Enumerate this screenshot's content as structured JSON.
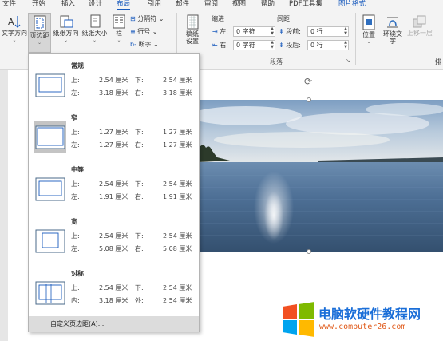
{
  "tabs": [
    "文件",
    "开始",
    "插入",
    "设计",
    "布局",
    "引用",
    "邮件",
    "审阅",
    "视图",
    "帮助",
    "PDF工具集",
    "图片格式"
  ],
  "ribbon": {
    "text_direction": "文字方向",
    "margins": "页边距",
    "orientation": "纸张方向",
    "size": "纸张大小",
    "columns": "栏",
    "breaks": "分隔符",
    "line_numbers": "行号",
    "hyphenation": "断字",
    "paper_setup": "稿纸设置",
    "indent_title": "缩进",
    "spacing_title": "间距",
    "indent_left_label": "左:",
    "indent_left_value": "0 字符",
    "indent_right_label": "右:",
    "indent_right_value": "0 字符",
    "space_before_label": "段前:",
    "space_before_value": "0 行",
    "space_after_label": "段后:",
    "space_after_value": "0 行",
    "paragraph_group": "段落",
    "position": "位置",
    "wrap_text": "环绕文字",
    "bring_forward": "上移一层",
    "arrange_short": "排"
  },
  "margins_menu": {
    "options": [
      {
        "name": "常规",
        "a_label": "上:",
        "a_value": "2.54 厘米",
        "b_label": "下:",
        "b_value": "2.54 厘米",
        "c_label": "左:",
        "c_value": "3.18 厘米",
        "d_label": "右:",
        "d_value": "3.18 厘米"
      },
      {
        "name": "窄",
        "a_label": "上:",
        "a_value": "1.27 厘米",
        "b_label": "下:",
        "b_value": "1.27 厘米",
        "c_label": "左:",
        "c_value": "1.27 厘米",
        "d_label": "右:",
        "d_value": "1.27 厘米"
      },
      {
        "name": "中等",
        "a_label": "上:",
        "a_value": "2.54 厘米",
        "b_label": "下:",
        "b_value": "2.54 厘米",
        "c_label": "左:",
        "c_value": "1.91 厘米",
        "d_label": "右:",
        "d_value": "1.91 厘米"
      },
      {
        "name": "宽",
        "a_label": "上:",
        "a_value": "2.54 厘米",
        "b_label": "下:",
        "b_value": "2.54 厘米",
        "c_label": "左:",
        "c_value": "5.08 厘米",
        "d_label": "右:",
        "d_value": "5.08 厘米"
      },
      {
        "name": "对称",
        "a_label": "上:",
        "a_value": "2.54 厘米",
        "b_label": "下:",
        "b_value": "2.54 厘米",
        "c_label": "内:",
        "c_value": "3.18 厘米",
        "d_label": "外:",
        "d_value": "2.54 厘米"
      }
    ],
    "selected_index": 1,
    "custom_label": "自定义页边距(A)..."
  },
  "watermark": {
    "title": "电脑软硬件教程网",
    "url": "www.computer26.com"
  },
  "colors": {
    "accent": "#185abd",
    "ribbon_bg": "#f3f3f3"
  }
}
